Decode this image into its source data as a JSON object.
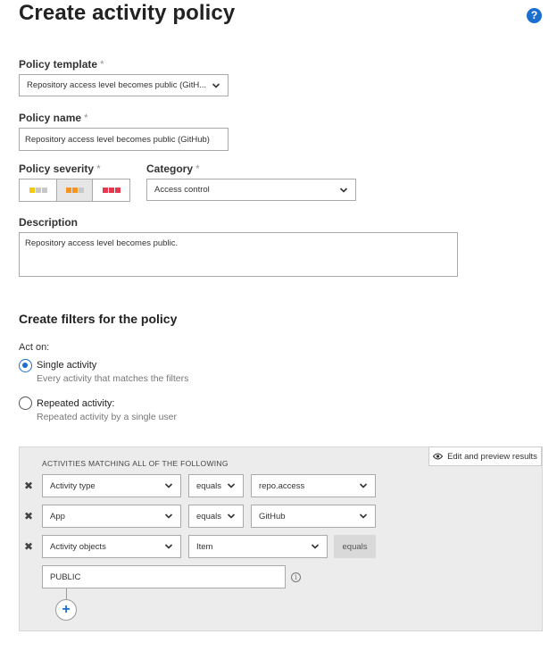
{
  "page": {
    "title": "Create activity policy",
    "help_icon": "help-icon",
    "help_glyph": "?"
  },
  "form": {
    "required_mark": "*",
    "template": {
      "label": "Policy template",
      "value": "Repository access level becomes public (GitH..."
    },
    "name": {
      "label": "Policy name",
      "value": "Repository access level becomes public (GitHub)"
    },
    "severity": {
      "label": "Policy severity",
      "levels": [
        {
          "name": "low",
          "color": "#f2c811",
          "selected": false
        },
        {
          "name": "medium",
          "color": "#f7931e",
          "selected": true
        },
        {
          "name": "high",
          "color": "#e8384f",
          "selected": false
        }
      ]
    },
    "category": {
      "label": "Category",
      "value": "Access control"
    },
    "description": {
      "label": "Description",
      "value": "Repository access level becomes public."
    }
  },
  "filters": {
    "heading": "Create filters for the policy",
    "act_on_label": "Act on:",
    "options": [
      {
        "title": "Single activity",
        "subtitle": "Every activity that matches the filters",
        "selected": true
      },
      {
        "title": "Repeated activity:",
        "subtitle": "Repeated activity by a single user",
        "selected": false
      }
    ],
    "panel": {
      "caption": "ACTIVITIES MATCHING ALL OF THE FOLLOWING",
      "edit_button": "Edit and preview results",
      "rows": [
        {
          "field": "Activity type",
          "operator": "equals",
          "value": "repo.access"
        },
        {
          "field": "App",
          "operator": "equals",
          "value": "GitHub"
        },
        {
          "field": "Activity objects",
          "operator": "Item",
          "value": "equals"
        }
      ],
      "value_input": "PUBLIC",
      "remove_glyph": "✖",
      "info_glyph": "i",
      "add_glyph": "+"
    }
  }
}
